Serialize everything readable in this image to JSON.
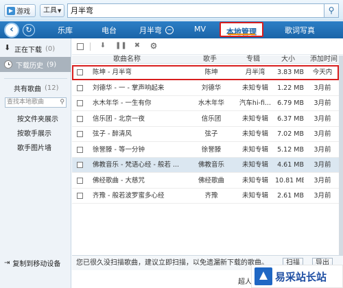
{
  "topbar": {
    "game_label": "游戏",
    "tools_label": "工具",
    "search_value": "月半弯"
  },
  "nav": {
    "items": [
      "乐库",
      "电台",
      "月半弯",
      "MV",
      "本地管理",
      "歌词写真"
    ],
    "active_index": 4
  },
  "sidebar": {
    "downloading_label": "正在下载",
    "downloading_count": "(0)",
    "history_label": "下载历史",
    "history_count": "(9)",
    "shared_label": "共有歌曲",
    "shared_count": "(12)",
    "search_placeholder": "查找本地歌曲",
    "link_folder": "按文件夹展示",
    "link_singer": "按歌手展示",
    "link_photo": "歌手图片墙",
    "copy_device": "复制到移动设备"
  },
  "table": {
    "headers": [
      "歌曲名称",
      "歌手",
      "专辑",
      "大小",
      "添加时间"
    ],
    "rows": [
      {
        "name": "陈坤 - 月半弯",
        "singer": "陈坤",
        "album": "月半湾",
        "size": "3.83 MB",
        "time": "今天内"
      },
      {
        "name": "刘德华 - 一 - 掌声响起来",
        "singer": "刘德华",
        "album": "未知专辑",
        "size": "1.22 MB",
        "time": "3月前"
      },
      {
        "name": "水木年华 - 一生有你",
        "singer": "水木年华",
        "album": "汽车hi-fi...",
        "size": "6.79 MB",
        "time": "3月前"
      },
      {
        "name": "信乐团 - 北京一夜",
        "singer": "信乐团",
        "album": "未知专辑",
        "size": "6.37 MB",
        "time": "3月前"
      },
      {
        "name": "弦子 - 醉清风",
        "singer": "弦子",
        "album": "未知专辑",
        "size": "7.02 MB",
        "time": "3月前"
      },
      {
        "name": "徐誉滕 - 等一分钟",
        "singer": "徐誉滕",
        "album": "未知专辑",
        "size": "5.12 MB",
        "time": "3月前"
      },
      {
        "name": "佛教音乐 - 梵语心经 - 般若 ...",
        "singer": "佛教音乐",
        "album": "未知专辑",
        "size": "4.61 MB",
        "time": "3月前"
      },
      {
        "name": "佛经歌曲 - 大慈咒",
        "singer": "佛经歌曲",
        "album": "未知专辑",
        "size": "10.81 MB",
        "time": "3月前"
      },
      {
        "name": "齐豫 - 般若波罗蜜多心经",
        "singer": "齐豫",
        "album": "未知专辑",
        "size": "2.61 MB",
        "time": "3月前"
      }
    ]
  },
  "status": {
    "message": "您已很久没扫描歌曲，建议立即扫描，以免遗漏新下载的歌曲。",
    "btn1": "扫描",
    "btn2": "导出"
  },
  "footer": {
    "text": "超人"
  },
  "watermark": {
    "text": "易采站长站"
  }
}
